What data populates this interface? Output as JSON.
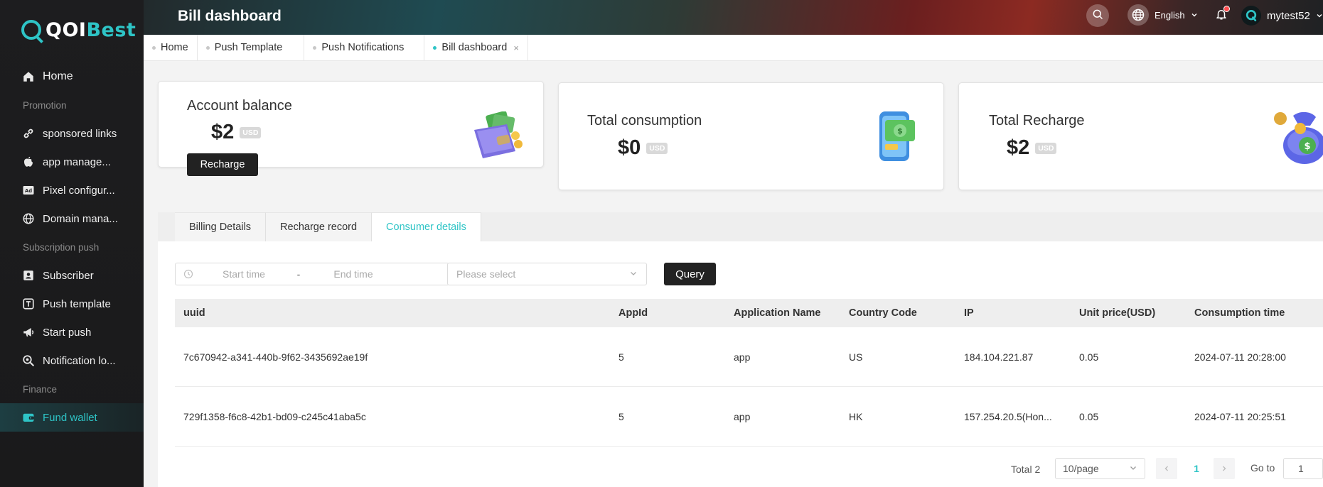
{
  "brand": {
    "logo_part1": "QOI",
    "logo_part2": "Best"
  },
  "sidebar": {
    "items": [
      {
        "type": "item",
        "label": "Home",
        "icon": "home-icon"
      },
      {
        "type": "group",
        "label": "Promotion"
      },
      {
        "type": "item",
        "label": "sponsored links",
        "icon": "link-icon"
      },
      {
        "type": "item",
        "label": "app manage...",
        "icon": "apple-icon"
      },
      {
        "type": "item",
        "label": "Pixel configur...",
        "icon": "ad-icon"
      },
      {
        "type": "item",
        "label": "Domain mana...",
        "icon": "globe-icon"
      },
      {
        "type": "group",
        "label": "Subscription push"
      },
      {
        "type": "item",
        "label": "Subscriber",
        "icon": "subscriber-icon"
      },
      {
        "type": "item",
        "label": "Push template",
        "icon": "template-icon"
      },
      {
        "type": "item",
        "label": "Start push",
        "icon": "megaphone-icon"
      },
      {
        "type": "item",
        "label": "Notification lo...",
        "icon": "log-search-icon"
      },
      {
        "type": "group",
        "label": "Finance"
      },
      {
        "type": "item",
        "label": "Fund wallet",
        "icon": "wallet-icon",
        "active": true
      }
    ]
  },
  "header": {
    "title": "Bill dashboard",
    "language": "English",
    "username": "mytest52"
  },
  "tags": [
    {
      "label": "Home"
    },
    {
      "label": "Push Template"
    },
    {
      "label": "Push Notifications"
    },
    {
      "label": "Bill dashboard",
      "active": true,
      "close": "×"
    }
  ],
  "cards": {
    "balance": {
      "title": "Account balance",
      "value": "$2",
      "currency": "USD",
      "button": "Recharge"
    },
    "consumption": {
      "title": "Total consumption",
      "value": "$0",
      "currency": "USD"
    },
    "recharge": {
      "title": "Total Recharge",
      "value": "$2",
      "currency": "USD"
    }
  },
  "tabs": [
    {
      "label": "Billing Details"
    },
    {
      "label": "Recharge record"
    },
    {
      "label": "Consumer details",
      "active": true
    }
  ],
  "filters": {
    "start_placeholder": "Start time",
    "separator": "-",
    "end_placeholder": "End time",
    "select_placeholder": "Please select",
    "query_label": "Query"
  },
  "table": {
    "columns": [
      "uuid",
      "AppId",
      "Application Name",
      "Country Code",
      "IP",
      "Unit price(USD)",
      "Consumption time"
    ],
    "rows": [
      [
        "7c670942-a341-440b-9f62-3435692ae19f",
        "5",
        "app",
        "US",
        "184.104.221.87",
        "0.05",
        "2024-07-11 20:28:00"
      ],
      [
        "729f1358-f6c8-42b1-bd09-c245c41aba5c",
        "5",
        "app",
        "HK",
        "157.254.20.5(Hon...",
        "0.05",
        "2024-07-11 20:25:51"
      ]
    ]
  },
  "pagination": {
    "total": "Total 2",
    "page_size": "10/page",
    "current_page": "1",
    "goto_label": "Go to",
    "goto_value": "1"
  },
  "colors": {
    "accent": "#2ec4c6",
    "sidebar_bg": "#1d1d1f",
    "button_dark": "#222222"
  }
}
